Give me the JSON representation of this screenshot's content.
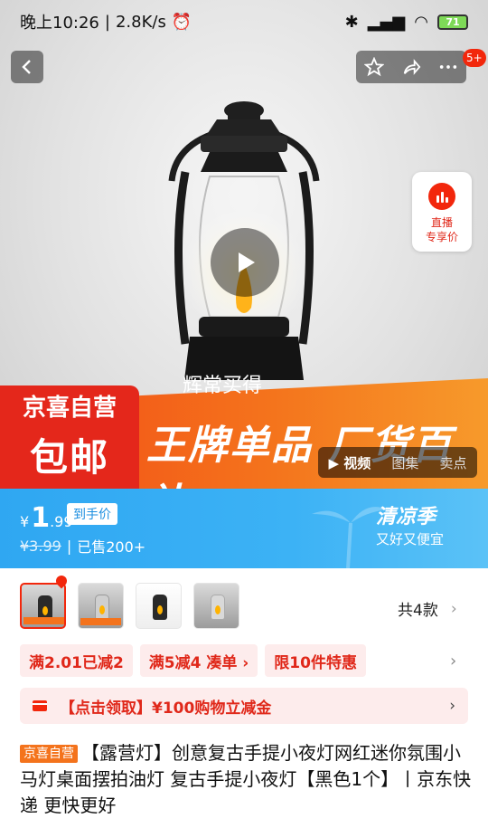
{
  "status_bar": {
    "time": "晚上10:26",
    "speed": "2.8K/s",
    "battery": "71"
  },
  "top_bar": {
    "notification_count": "5+"
  },
  "live": {
    "label": "直播\n专享价",
    "label_line1": "直播",
    "label_line2": "专享价"
  },
  "hero": {
    "caption": "辉常买得",
    "brand_top": "京喜自营",
    "brand_bottom": "包邮",
    "slogan": "王牌单品 厂货百补",
    "media_tabs": [
      "视频",
      "图集",
      "卖点"
    ],
    "colors": {
      "banner_orange": "#f4731c",
      "brand_red": "#e4271b"
    }
  },
  "price": {
    "currency": "¥",
    "integer": "1",
    "decimal": ".99",
    "to_hand_label": "到手价",
    "original": "¥3.99",
    "sold": "已售200+",
    "season_title": "清凉季",
    "season_sub": "又好又便宜",
    "bar_color": "#3cb2f5"
  },
  "thumbnails": {
    "count_label": "共4款",
    "items": [
      "thumb-1",
      "thumb-2",
      "thumb-3",
      "thumb-4"
    ]
  },
  "promotions": {
    "items": [
      "满2.01已减2",
      "满5减4  凑单 ›",
      "限10件特惠"
    ]
  },
  "coupon": {
    "text": "【点击领取】¥100购物立减金"
  },
  "product": {
    "badge": "京喜自营",
    "title": "【露营灯】创意复古手提小夜灯网红迷你氛围小马灯桌面摆拍油灯 复古手提小夜灯【黑色1个】丨京东快递 更快更好"
  }
}
